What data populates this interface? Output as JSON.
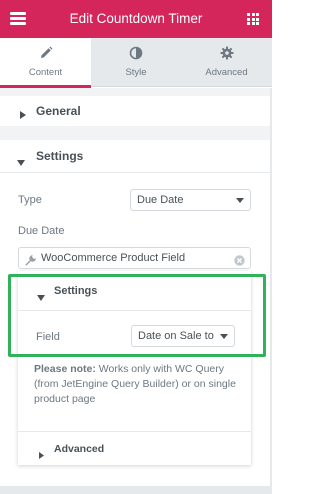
{
  "header": {
    "title": "Edit Countdown Timer"
  },
  "tabs": [
    {
      "label": "Content",
      "icon": "pencil-icon"
    },
    {
      "label": "Style",
      "icon": "half-circle-icon"
    },
    {
      "label": "Advanced",
      "icon": "gear-icon"
    }
  ],
  "sections": {
    "general": "General",
    "settings": "Settings"
  },
  "controls": {
    "type_label": "Type",
    "type_value": "Due Date",
    "due_date_label": "Due Date",
    "due_date_value": "WooCommerce Product Field"
  },
  "popover": {
    "settings_title": "Settings",
    "field_label": "Field",
    "field_value": "Date on Sale to",
    "note_bold": "Please note:",
    "note_text": " Works only with WC Query (from JetEngine Query Builder) or on single product page",
    "advanced_title": "Advanced"
  },
  "colors": {
    "accent": "#d5265c",
    "highlight": "#2fb25a",
    "panel_gray": "#e6e9ec"
  }
}
